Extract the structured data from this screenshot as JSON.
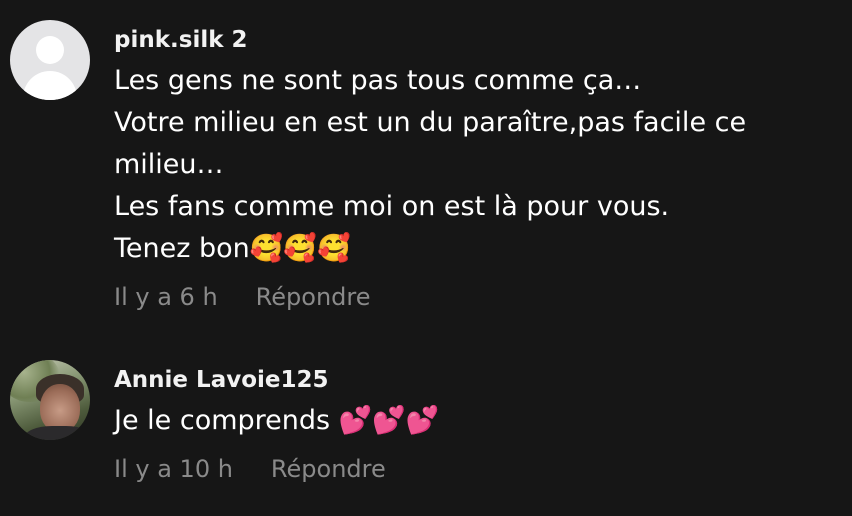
{
  "comments": [
    {
      "username": "pink.silk 2",
      "avatar_icon": "default-avatar-icon",
      "text": "Les gens ne sont pas tous comme ça…\nVotre milieu en est un du paraître,pas facile ce\nmilieu…\nLes fans comme moi on est là pour vous.\nTenez bon🥰🥰🥰",
      "time": "Il y a 6 h",
      "reply_label": "Répondre"
    },
    {
      "username": "Annie Lavoie125",
      "avatar_icon": "profile-photo",
      "text": "Je le comprends 💕💕💕",
      "time": "Il y a 10 h",
      "reply_label": "Répondre"
    }
  ],
  "colors": {
    "background": "#161616",
    "text": "#ffffff",
    "meta": "#8a8a8a"
  }
}
